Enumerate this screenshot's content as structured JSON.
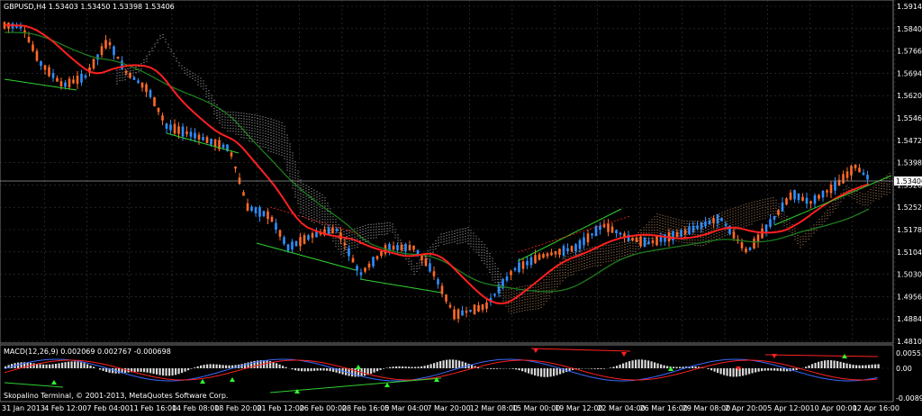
{
  "chart": {
    "symbol_header": "GBPUSD,H4  1.53403 1.53450 1.53398 1.53406",
    "current_price_label": "1.53406",
    "price_axis_labels": [
      "1.59140",
      "1.58400",
      "1.57660",
      "1.56940",
      "1.56200",
      "1.55460",
      "1.54720",
      "1.53980",
      "1.53260",
      "1.52520",
      "1.51780",
      "1.51040",
      "1.50300",
      "1.49560",
      "1.48840",
      "1.48100"
    ],
    "time_axis_labels": [
      "31 Jan 2013",
      "4 Feb 12:00",
      "7 Feb 04:00",
      "11 Feb 16:00",
      "14 Feb 08:00",
      "18 Feb 20:00",
      "21 Feb 12:00",
      "26 Feb 00:00",
      "28 Feb 16:00",
      "5 Mar 04:00",
      "7 Mar 20:00",
      "12 Mar 08:00",
      "15 Mar 00:00",
      "19 Mar 12:00",
      "22 Mar 04:00",
      "26 Mar 16:00",
      "29 Mar 08:00",
      "2 Apr 20:00",
      "5 Apr 12:00",
      "10 Apr 00:00",
      "12 Apr 16:00"
    ]
  },
  "macd": {
    "header": "MACD(12,26,9) 0.002069 0.002767 -0.000698",
    "axis_labels": [
      "0.005524",
      "0.00",
      "-0.008913"
    ]
  },
  "footer": {
    "copyright": "Skopalino Terminal, © 2001-2013, MetaQuotes Software Corp."
  },
  "colors": {
    "background": "#000000",
    "bull_candle": "#2f8fff",
    "bear_candle": "#ff6a28",
    "ma_fast": "#ff2020",
    "ma_slow": "#1e7d1e",
    "trendline": "#30d030",
    "kumo": "#d8d8d8",
    "kumo_lower": "#d9a070",
    "grid": "#3a3a3a",
    "macd_hist": "#d8d8d8",
    "macd_main": "#3a6bff",
    "macd_signal": "#ff2020"
  }
}
